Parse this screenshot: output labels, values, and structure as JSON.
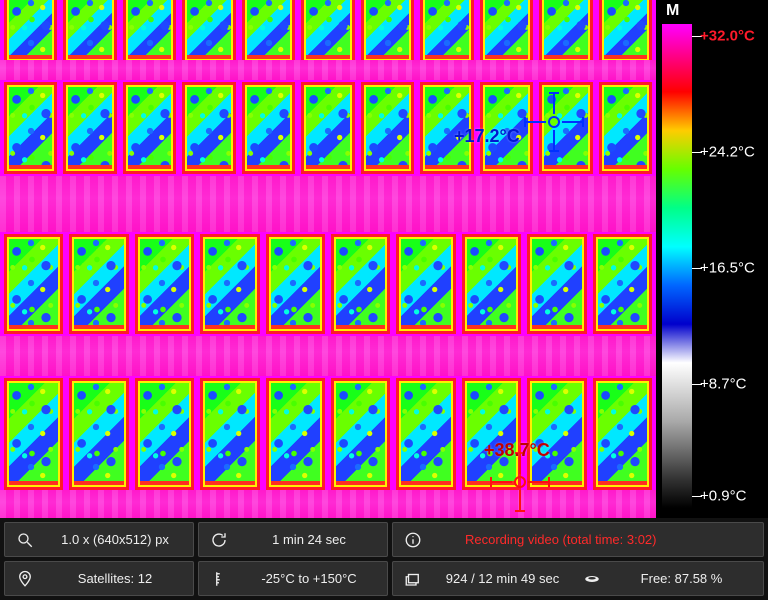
{
  "markers": {
    "cold": {
      "temp": "+17.2°C",
      "color": "#0030ff"
    },
    "hot": {
      "temp": "+38.7°C",
      "color": "#ff1010"
    }
  },
  "scale": {
    "mode": "M",
    "labels": {
      "max": "+32.0°C",
      "q3": "+24.2°C",
      "q2": "+16.5°C",
      "q1": "+8.7°C",
      "min": "+0.9°C"
    }
  },
  "status": {
    "zoom": "1.0 x (640x512) px",
    "interval": "1 min 24 sec",
    "recording": "Recording video (total time: 3:02)",
    "satellites": "Satellites: 12",
    "temp_range": "-25°C to +150°C",
    "captures": "924 / 12 min 49 sec",
    "storage": "Free: 87.58 %"
  }
}
